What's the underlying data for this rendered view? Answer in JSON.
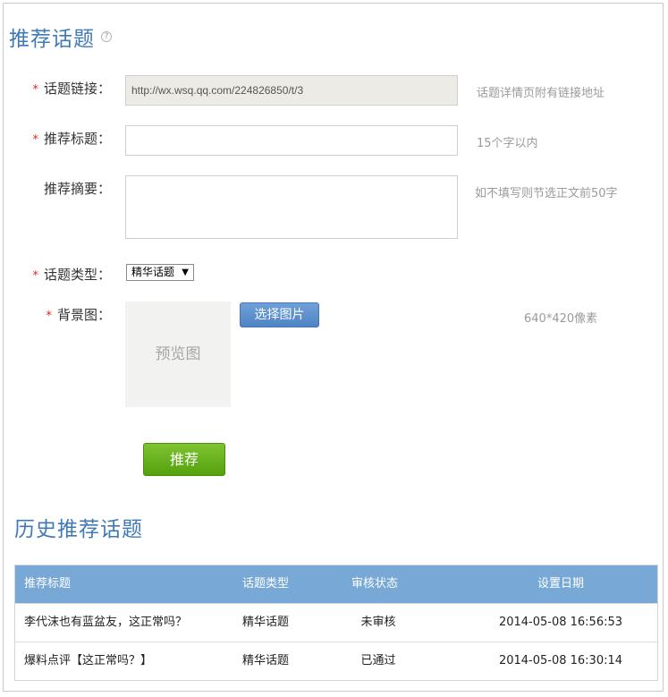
{
  "page": {
    "title": "推荐话题",
    "help_icon": "?"
  },
  "form": {
    "link": {
      "label": "话题链接：",
      "required": "*",
      "value": "http://wx.wsq.qq.com/224826850/t/3",
      "hint": "话题详情页附有链接地址"
    },
    "title": {
      "label": "推荐标题：",
      "required": "*",
      "value": "",
      "hint": "15个字以内"
    },
    "summary": {
      "label": "推荐摘要：",
      "value": "",
      "hint": "如不填写则节选正文前50字"
    },
    "type": {
      "label": "话题类型：",
      "required": "*",
      "selected": "精华话题"
    },
    "background": {
      "label": "背景图：",
      "required": "*",
      "preview_text": "预览图",
      "choose_button": "选择图片",
      "hint": "640*420像素"
    },
    "submit_button": "推荐"
  },
  "history": {
    "title": "历史推荐话题",
    "columns": [
      "推荐标题",
      "话题类型",
      "审核状态",
      "设置日期"
    ],
    "rows": [
      [
        "李代沫也有蓝盆友，这正常吗？",
        "精华话题",
        "未审核",
        "2014-05-08 16:56:53"
      ],
      [
        "爆料点评【这正常吗？】",
        "精华话题",
        "已通过",
        "2014-05-08 16:30:14"
      ]
    ]
  },
  "colors": {
    "accent": "#3f79b6",
    "table_header": "#78a8d6",
    "submit_green": "#6ab423",
    "required_red": "#e1251b"
  }
}
